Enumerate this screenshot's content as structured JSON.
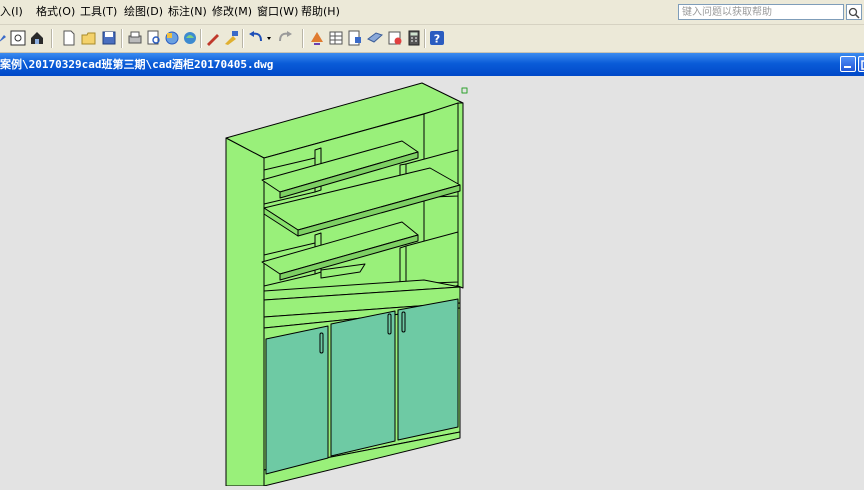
{
  "menu": {
    "items": [
      "入(I)",
      "格式(O)",
      "工具(T)",
      "绘图(D)",
      "标注(N)",
      "修改(M)",
      "窗口(W)",
      "帮助(H)"
    ]
  },
  "help_search": {
    "placeholder": "键入问题以获取帮助"
  },
  "toolbar": {
    "buttons": [
      "select-icon",
      "zoom-icon",
      "home-icon",
      "new-file-icon",
      "open-file-icon",
      "save-icon",
      "print-icon",
      "print-preview-icon",
      "publish-icon",
      "plot-icon",
      "pen-icon",
      "match-properties-icon",
      "undo-icon",
      "redo-icon",
      "design-center-icon",
      "properties-icon",
      "tool-palette-icon",
      "sheet-set-icon",
      "markup-icon",
      "calculator-icon",
      "help-icon"
    ]
  },
  "document": {
    "title": "案例\\20170329cad班第三期\\cad酒柜20170405.dwg"
  },
  "colors": {
    "menubar": "#ece9d8",
    "titlebar": "#0a5cd8",
    "canvas_bg": "#e3e3e3",
    "cabinet_green": "#99f07a",
    "door_teal": "#6ecaa4"
  }
}
